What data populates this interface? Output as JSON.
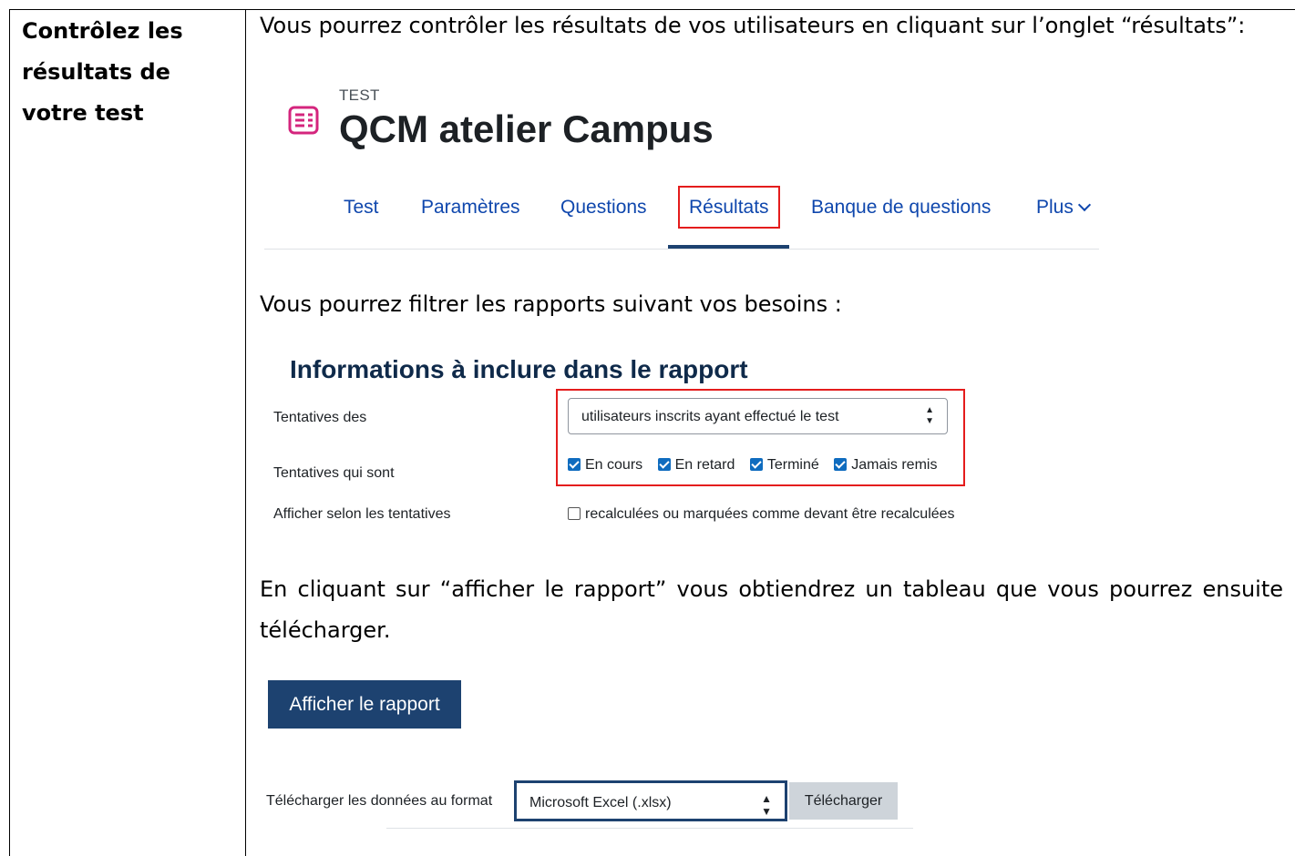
{
  "section": {
    "title": "Contrôlez les\nrésultats de\nvotre test"
  },
  "intro_text": "Vous pourrez contrôler les résultats de vos utilisateurs en cliquant sur l’onglet “résultats”:",
  "quiz": {
    "kicker": "TEST",
    "title": "QCM atelier Campus",
    "icon": "quiz-list-icon",
    "accent_color": "#d4257d"
  },
  "tabs": [
    {
      "label": "Test"
    },
    {
      "label": "Paramètres"
    },
    {
      "label": "Questions"
    },
    {
      "label": "Résultats",
      "active": true
    },
    {
      "label": "Banque de questions"
    },
    {
      "label": "Plus"
    }
  ],
  "filter_text": "Vous pourrez filtrer les rapports suivant vos besoins :",
  "report_options": {
    "heading": "Informations à inclure dans le rapport",
    "attempts_from_label": "Tentatives des",
    "attempts_from_value": "utilisateurs inscrits ayant effectué le test",
    "attempts_state_label": "Tentatives qui sont",
    "states": [
      {
        "label": "En cours",
        "checked": true
      },
      {
        "label": "En retard",
        "checked": true
      },
      {
        "label": "Terminé",
        "checked": true
      },
      {
        "label": "Jamais remis",
        "checked": true
      }
    ],
    "show_label": "Afficher selon les tentatives",
    "regrade_label": "recalculées ou marquées comme devant être recalculées",
    "regrade_checked": false
  },
  "report_text": "En cliquant sur “afficher le rapport” vous obtiendrez un tableau que vous pourrez ensuite télécharger.",
  "show_report_button": "Afficher le rapport",
  "download": {
    "label": "Télécharger les données au format",
    "format": "Microsoft Excel (.xlsx)",
    "button": "Télécharger"
  },
  "colors": {
    "highlight": "#e41c1c",
    "primary": "#1d4270",
    "link": "#0f47ad",
    "checkbox": "#0f6cbf"
  }
}
